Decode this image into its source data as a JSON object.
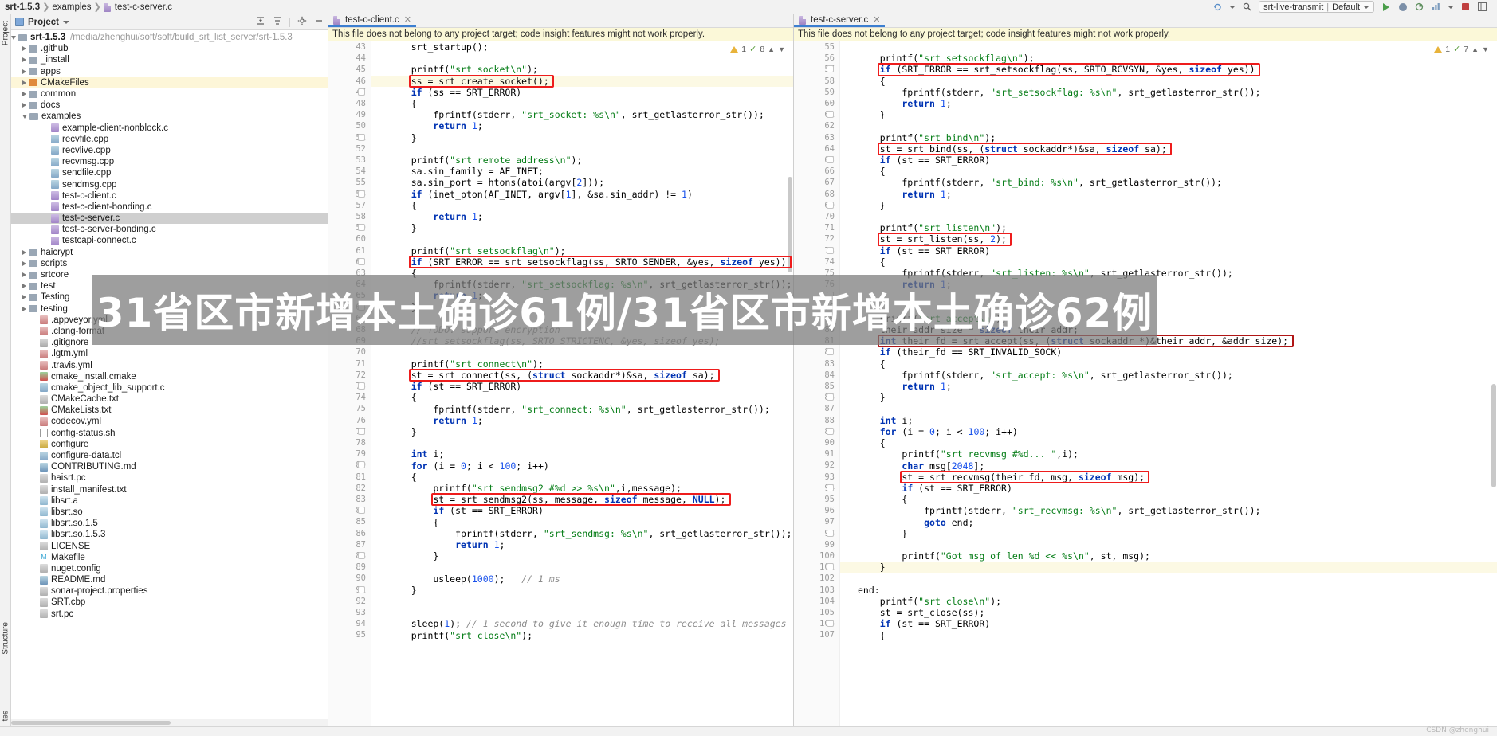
{
  "breadcrumb": {
    "project": "srt-1.5.3",
    "folder": "examples",
    "file": "test-c-server.c"
  },
  "toolbar": {
    "run_config": "srt-live-transmit",
    "run_config_profile": "Default",
    "run_label": "Run",
    "debug_label": "Debug",
    "stop_label": "Stop",
    "search_label": "Search",
    "layout_label": "Layout"
  },
  "project_panel": {
    "title": "Project",
    "collapse_all_label": "Collapse All",
    "expand_all_label": "Expand All",
    "settings_label": "Settings",
    "hide_label": "Hide",
    "root": {
      "name": "srt-1.5.3",
      "path": "/media/zhenghui/soft/soft/build_srt_list_server/srt-1.5.3"
    },
    "items": [
      {
        "label": ".github",
        "type": "folder",
        "indent": 1,
        "arrow": "right",
        "state": ""
      },
      {
        "label": "_install",
        "type": "folder",
        "indent": 1,
        "arrow": "right",
        "state": ""
      },
      {
        "label": "apps",
        "type": "folder",
        "indent": 1,
        "arrow": "right",
        "state": ""
      },
      {
        "label": "CMakeFiles",
        "type": "folder-orange",
        "indent": 1,
        "arrow": "right",
        "state": "highlighted"
      },
      {
        "label": "common",
        "type": "folder",
        "indent": 1,
        "arrow": "right",
        "state": ""
      },
      {
        "label": "docs",
        "type": "folder",
        "indent": 1,
        "arrow": "right",
        "state": ""
      },
      {
        "label": "examples",
        "type": "folder",
        "indent": 1,
        "arrow": "down",
        "state": ""
      },
      {
        "label": "example-client-nonblock.c",
        "type": "c",
        "indent": 3,
        "arrow": "none",
        "state": ""
      },
      {
        "label": "recvfile.cpp",
        "type": "cpp",
        "indent": 3,
        "arrow": "none",
        "state": ""
      },
      {
        "label": "recvlive.cpp",
        "type": "cpp",
        "indent": 3,
        "arrow": "none",
        "state": ""
      },
      {
        "label": "recvmsg.cpp",
        "type": "cpp",
        "indent": 3,
        "arrow": "none",
        "state": ""
      },
      {
        "label": "sendfile.cpp",
        "type": "cpp",
        "indent": 3,
        "arrow": "none",
        "state": ""
      },
      {
        "label": "sendmsg.cpp",
        "type": "cpp",
        "indent": 3,
        "arrow": "none",
        "state": ""
      },
      {
        "label": "test-c-client.c",
        "type": "c",
        "indent": 3,
        "arrow": "none",
        "state": ""
      },
      {
        "label": "test-c-client-bonding.c",
        "type": "c",
        "indent": 3,
        "arrow": "none",
        "state": ""
      },
      {
        "label": "test-c-server.c",
        "type": "c",
        "indent": 3,
        "arrow": "none",
        "state": "selected"
      },
      {
        "label": "test-c-server-bonding.c",
        "type": "c",
        "indent": 3,
        "arrow": "none",
        "state": ""
      },
      {
        "label": "testcapi-connect.c",
        "type": "c",
        "indent": 3,
        "arrow": "none",
        "state": ""
      },
      {
        "label": "haicrypt",
        "type": "folder",
        "indent": 1,
        "arrow": "right",
        "state": ""
      },
      {
        "label": "scripts",
        "type": "folder",
        "indent": 1,
        "arrow": "right",
        "state": ""
      },
      {
        "label": "srtcore",
        "type": "folder",
        "indent": 1,
        "arrow": "right",
        "state": ""
      },
      {
        "label": "test",
        "type": "folder",
        "indent": 1,
        "arrow": "right",
        "state": ""
      },
      {
        "label": "Testing",
        "type": "folder",
        "indent": 1,
        "arrow": "right",
        "state": ""
      },
      {
        "label": "testing",
        "type": "folder",
        "indent": 1,
        "arrow": "right",
        "state": ""
      },
      {
        "label": ".appveyor.yml",
        "type": "yml",
        "indent": 2,
        "arrow": "none",
        "state": ""
      },
      {
        "label": ".clang-format",
        "type": "yml",
        "indent": 2,
        "arrow": "none",
        "state": ""
      },
      {
        "label": ".gitignore",
        "type": "git",
        "indent": 2,
        "arrow": "none",
        "state": ""
      },
      {
        "label": ".lgtm.yml",
        "type": "yml",
        "indent": 2,
        "arrow": "none",
        "state": ""
      },
      {
        "label": ".travis.yml",
        "type": "yml",
        "indent": 2,
        "arrow": "none",
        "state": ""
      },
      {
        "label": "cmake_install.cmake",
        "type": "cmake",
        "indent": 2,
        "arrow": "none",
        "state": ""
      },
      {
        "label": "cmake_object_lib_support.c",
        "type": "cpp",
        "indent": 2,
        "arrow": "none",
        "state": ""
      },
      {
        "label": "CMakeCache.txt",
        "type": "txt",
        "indent": 2,
        "arrow": "none",
        "state": ""
      },
      {
        "label": "CMakeLists.txt",
        "type": "cmake",
        "indent": 2,
        "arrow": "none",
        "state": ""
      },
      {
        "label": "codecov.yml",
        "type": "yml",
        "indent": 2,
        "arrow": "none",
        "state": ""
      },
      {
        "label": "config-status.sh",
        "type": "sh",
        "indent": 2,
        "arrow": "none",
        "state": ""
      },
      {
        "label": "configure",
        "type": "cfg",
        "indent": 2,
        "arrow": "none",
        "state": ""
      },
      {
        "label": "configure-data.tcl",
        "type": "cpp",
        "indent": 2,
        "arrow": "none",
        "state": ""
      },
      {
        "label": "CONTRIBUTING.md",
        "type": "md",
        "indent": 2,
        "arrow": "none",
        "state": ""
      },
      {
        "label": "haisrt.pc",
        "type": "txt",
        "indent": 2,
        "arrow": "none",
        "state": ""
      },
      {
        "label": "install_manifest.txt",
        "type": "txt",
        "indent": 2,
        "arrow": "none",
        "state": ""
      },
      {
        "label": "libsrt.a",
        "type": "so",
        "indent": 2,
        "arrow": "none",
        "state": ""
      },
      {
        "label": "libsrt.so",
        "type": "so",
        "indent": 2,
        "arrow": "none",
        "state": ""
      },
      {
        "label": "libsrt.so.1.5",
        "type": "so",
        "indent": 2,
        "arrow": "none",
        "state": ""
      },
      {
        "label": "libsrt.so.1.5.3",
        "type": "so",
        "indent": 2,
        "arrow": "none",
        "state": ""
      },
      {
        "label": "LICENSE",
        "type": "txt",
        "indent": 2,
        "arrow": "none",
        "state": ""
      },
      {
        "label": "Makefile",
        "type": "mk",
        "indent": 2,
        "arrow": "none",
        "state": ""
      },
      {
        "label": "nuget.config",
        "type": "txt",
        "indent": 2,
        "arrow": "none",
        "state": ""
      },
      {
        "label": "README.md",
        "type": "md",
        "indent": 2,
        "arrow": "none",
        "state": ""
      },
      {
        "label": "sonar-project.properties",
        "type": "txt",
        "indent": 2,
        "arrow": "none",
        "state": ""
      },
      {
        "label": "SRT.cbp",
        "type": "txt",
        "indent": 2,
        "arrow": "none",
        "state": ""
      },
      {
        "label": "srt.pc",
        "type": "txt",
        "indent": 2,
        "arrow": "none",
        "state": ""
      }
    ]
  },
  "tool_strips": {
    "project_label": "Project",
    "structure_label": "Structure",
    "favorites_label": "ites"
  },
  "editor_left": {
    "tab_label": "test-c-client.c",
    "notice": "This file does not belong to any project target; code insight features might not work properly.",
    "first_line": 43,
    "current_line": 46,
    "lines": [
      "    srt_startup();",
      "",
      "    printf(\"srt socket\\n\");",
      "    ss = srt_create_socket();",
      "    if (ss == SRT_ERROR)",
      "    {",
      "        fprintf(stderr, \"srt_socket: %s\\n\", srt_getlasterror_str());",
      "        return 1;",
      "    }",
      "",
      "    printf(\"srt remote address\\n\");",
      "    sa.sin_family = AF_INET;",
      "    sa.sin_port = htons(atoi(argv[2]));",
      "    if (inet_pton(AF_INET, argv[1], &sa.sin_addr) != 1)",
      "    {",
      "        return 1;",
      "    }",
      "",
      "    printf(\"srt setsockflag\\n\");",
      "    if (SRT_ERROR == srt_setsockflag(ss, SRTO_SENDER, &yes, sizeof yes))",
      "    {",
      "        fprintf(stderr, \"srt_setsockflag: %s\\n\", srt_getlasterror_str());",
      "        return 1;",
      "    }",
      "",
      "    // TODO: support encryption",
      "    //srt_setsockflag(ss, SRTO_STRICTENC, &yes, sizeof yes);",
      "",
      "    printf(\"srt connect\\n\");",
      "    st = srt_connect(ss, (struct sockaddr*)&sa, sizeof sa);",
      "    if (st == SRT_ERROR)",
      "    {",
      "        fprintf(stderr, \"srt_connect: %s\\n\", srt_getlasterror_str());",
      "        return 1;",
      "    }",
      "",
      "    int i;",
      "    for (i = 0; i < 100; i++)",
      "    {",
      "        printf(\"srt sendmsg2 #%d >> %s\\n\",i,message);",
      "        st = srt_sendmsg2(ss, message, sizeof message, NULL);",
      "        if (st == SRT_ERROR)",
      "        {",
      "            fprintf(stderr, \"srt_sendmsg: %s\\n\", srt_getlasterror_str());",
      "            return 1;",
      "        }",
      "",
      "        usleep(1000);   // 1 ms",
      "    }",
      "",
      "",
      "    sleep(1); // 1 second to give it enough time to receive all messages",
      "    printf(\"srt close\\n\");"
    ],
    "highlight_boxes": [
      "ss = srt_create_socket();",
      "if (SRT_ERROR == srt_setsockflag(ss, SRTO_SENDER, &yes, sizeof yes))",
      "st = srt_connect(ss, (struct sockaddr*)&sa, sizeof sa);",
      "st = srt_sendmsg2(ss, message, sizeof message, NULL);"
    ],
    "inspection": {
      "warnings": "1",
      "checks": "8"
    }
  },
  "editor_right": {
    "tab_label": "test-c-server.c",
    "notice": "This file does not belong to any project target; code insight features might not work properly.",
    "first_line": 55,
    "current_line": 101,
    "lines": [
      "",
      "    printf(\"srt setsockflag\\n\");",
      "    if (SRT_ERROR == srt_setsockflag(ss, SRTO_RCVSYN, &yes, sizeof yes))",
      "    {",
      "        fprintf(stderr, \"srt_setsockflag: %s\\n\", srt_getlasterror_str());",
      "        return 1;",
      "    }",
      "",
      "    printf(\"srt bind\\n\");",
      "    st = srt_bind(ss, (struct sockaddr*)&sa, sizeof sa);",
      "    if (st == SRT_ERROR)",
      "    {",
      "        fprintf(stderr, \"srt_bind: %s\\n\", srt_getlasterror_str());",
      "        return 1;",
      "    }",
      "",
      "    printf(\"srt listen\\n\");",
      "    st = srt_listen(ss, 2);",
      "    if (st == SRT_ERROR)",
      "    {",
      "        fprintf(stderr, \"srt_listen: %s\\n\", srt_getlasterror_str());",
      "        return 1;",
      "    }",
      "",
      "    printf(\"srt accept\\n\");",
      "    their_addr_size = sizeof their_addr;",
      "    int their_fd = srt_accept(ss, (struct sockaddr *)&their_addr, &addr_size);",
      "    if (their_fd == SRT_INVALID_SOCK)",
      "    {",
      "        fprintf(stderr, \"srt_accept: %s\\n\", srt_getlasterror_str());",
      "        return 1;",
      "    }",
      "",
      "    int i;",
      "    for (i = 0; i < 100; i++)",
      "    {",
      "        printf(\"srt recvmsg #%d... \",i);",
      "        char msg[2048];",
      "        st = srt_recvmsg(their_fd, msg, sizeof msg);",
      "        if (st == SRT_ERROR)",
      "        {",
      "            fprintf(stderr, \"srt_recvmsg: %s\\n\", srt_getlasterror_str());",
      "            goto end;",
      "        }",
      "",
      "        printf(\"Got msg of len %d << %s\\n\", st, msg);",
      "    }",
      "",
      "end:",
      "    printf(\"srt close\\n\");",
      "    st = srt_close(ss);",
      "    if (st == SRT_ERROR)",
      "    {"
    ],
    "highlight_boxes": [
      "if (SRT_ERROR == srt_setsockflag(ss, SRTO_RCVSYN, &yes, sizeof yes))",
      "st = srt_bind(ss, (struct sockaddr*)&sa, sizeof sa);",
      "st = srt_listen(ss, 2);",
      "int their_fd = srt_accept(ss, (struct sockaddr *)&their_addr, &addr_size);",
      "st = srt_recvmsg(their_fd, msg, sizeof msg);"
    ],
    "inspection": {
      "warnings": "1",
      "checks": "7"
    }
  },
  "watermark": {
    "text": "31省区市新增本土确诊61例/31省区市新增本土确诊62例",
    "corner_text": "CSDN @zhenghui",
    "background_color": "#787878",
    "text_color": "#ffffff"
  }
}
